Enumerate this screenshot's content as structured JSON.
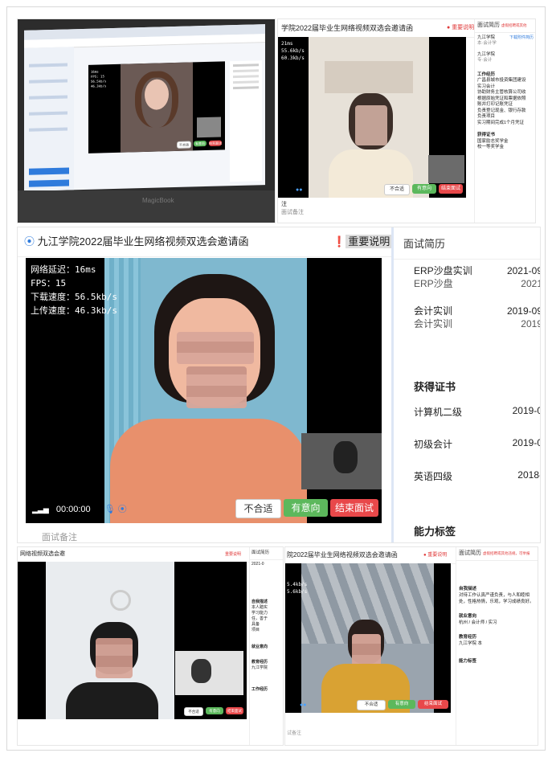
{
  "collage": {
    "p1": {
      "watermark": "MagicBook",
      "video_stats": [
        "16ms",
        "FPS: 15",
        "56.5kb/s",
        "46.3kb/s"
      ],
      "buttons": [
        "不合适",
        "有意向",
        "结束面试"
      ]
    },
    "p2": {
      "title": "学院2022届毕业生网络视频双选会邀请函",
      "notice": "重要说明",
      "side_title": "面试简历",
      "side_link": "虚假招聘或其他",
      "stats": [
        "21ms",
        "55.6kb/s",
        "60.3kb/s"
      ],
      "buttons": [
        "不合适",
        "有意向",
        "结束面试"
      ],
      "side_items": [
        "九江学院",
        "本·会计学",
        "九江学院",
        "专·会计",
        "工作经历",
        "广昌县城市投资集团建设",
        "实习会计",
        "协助财务主管核算公司收",
        "根据原始凭证和票据依照",
        "账并打印记账凭证",
        "负责登记现金、银行存款",
        "负责项目",
        "实习期间完成1个月凭证",
        "获得证书",
        "国家励志奖学金",
        "校一等奖学金"
      ],
      "side_right_label": "下载附件简历",
      "bottom_lines": [
        "注",
        "面试备注"
      ]
    },
    "main": {
      "title": "九江学院2022届毕业生网络视频双选会邀请函",
      "notice": "重要说明",
      "side_title": "面试简历",
      "stats": [
        "网络延迟：16ms",
        "FPS：15",
        "下载速度：56.5kb/s",
        "上传速度：46.3kb/s"
      ],
      "timer": "00:00:00",
      "buttons": [
        "不合适",
        "有意向",
        "结束面试"
      ],
      "bottom_label": "面试备注",
      "resume": [
        {
          "name": "ERP沙盘实训",
          "date": "2021-09",
          "sub": "ERP沙盘",
          "date2": "2021"
        },
        {
          "name": "会计实训",
          "date": "2019-09",
          "sub": "会计实训",
          "date2": "2019"
        }
      ],
      "certs_title": "获得证书",
      "certs": [
        {
          "name": "计算机二级",
          "date": "2019-0"
        },
        {
          "name": "初级会计",
          "date": "2019-0"
        },
        {
          "name": "英语四级",
          "date": "2018-"
        }
      ],
      "skills_title": "能力标签"
    },
    "p4": {
      "title": "网络视频双选会邀",
      "notice": "重要说明",
      "side_title": "面试简历",
      "side_items": [
        "2021-0",
        "自我描述",
        "本人踏实",
        "学习能力",
        "任，善于",
        "具备",
        "项目",
        "就业意向",
        "教育经历",
        "九江学院",
        "工作经历"
      ],
      "buttons": [
        "不合适",
        "有意向",
        "结束面试"
      ]
    },
    "p5": {
      "title": "院2022届毕业生网络视频双选会邀请函",
      "notice": "重要说明",
      "side_title": "面试简历",
      "side_link": "虚假招聘或其他违规，可举报",
      "stats": [
        "5.4kb/s",
        "5.6kb/s"
      ],
      "buttons": [
        "不合适",
        "有意向",
        "结束面试"
      ],
      "bottom_label": "试备注",
      "side_items": [
        {
          "h": "自我描述",
          "t": "对待工作认真严谨负责，与人和睦相处，性格热情，乐观，学习成绩良好。"
        },
        {
          "h": "就业意向",
          "t": "杭州 / 会计师 / 实习"
        },
        {
          "h": "教育经历",
          "t": "九江学院 本"
        },
        {
          "h": "能力标签",
          "t": ""
        }
      ]
    }
  }
}
